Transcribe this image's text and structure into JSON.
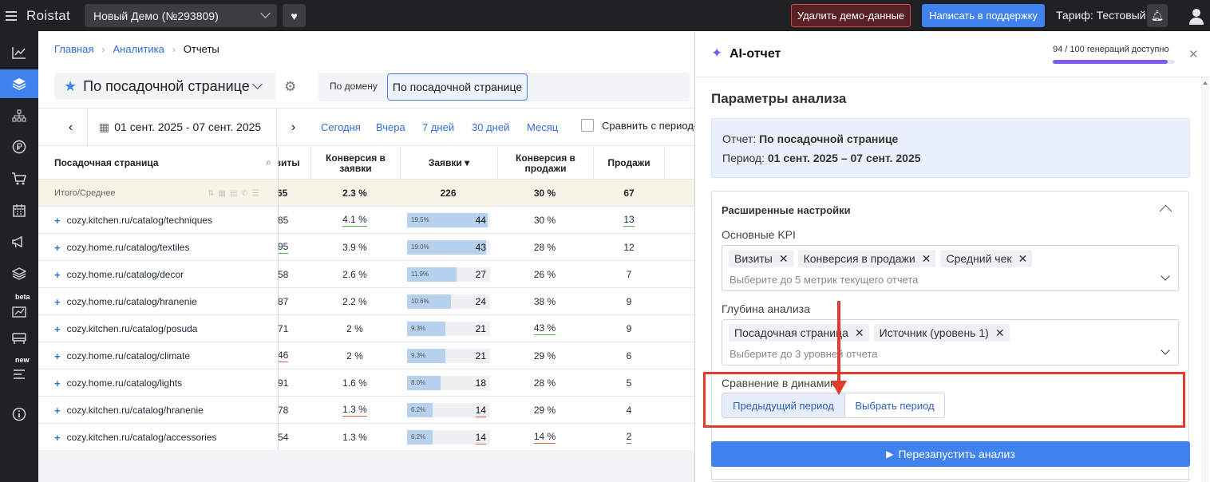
{
  "topbar": {
    "logo": "Roistat",
    "project": "Новый Демо (№293809)",
    "delete_demo": "Удалить демо-данные",
    "support": "Написать в поддержку",
    "tariff": "Тариф: Тестовый"
  },
  "sidebar": {
    "badge_beta": "beta",
    "badge_new": "new"
  },
  "breadcrumbs": {
    "home": "Главная",
    "analytics": "Аналитика",
    "current": "Отчеты"
  },
  "report": {
    "selector": "По посадочной странице",
    "tab_domain": "По домену",
    "tab_landing": "По посадочной странице"
  },
  "dates": {
    "range": "01 сент. 2025 - 07 сент. 2025",
    "today": "Сегодня",
    "yesterday": "Вчера",
    "week": "7 дней",
    "month30": "30 дней",
    "month": "Месяц",
    "compare": "Сравнить с периодом"
  },
  "table": {
    "headers": {
      "landing": "Посадочная страница",
      "visits": "Визиты",
      "conv_leads": "Конверсия в заявки",
      "leads": "Заявки ▾",
      "conv_sales": "Конверсия в продажи",
      "sales": "Продажи"
    },
    "total": {
      "label": "Итого/Среднее",
      "visits": "65",
      "conv_leads": "2.3 %",
      "leads": "226",
      "conv_sales": "30 %",
      "sales": "67"
    },
    "rows": [
      {
        "page": "cozy.kitchen.ru/catalog/techniques",
        "visits": "85",
        "conv_leads": "4.1 %",
        "share": "19.5%",
        "share_value": 19.5,
        "leads": "44",
        "conv_sales": "30 %",
        "sales": "13"
      },
      {
        "page": "cozy.home.ru/catalog/textiles",
        "visits": "95",
        "conv_leads": "3.9 %",
        "share": "19.0%",
        "share_value": 19.0,
        "leads": "43",
        "conv_sales": "28 %",
        "sales": "12"
      },
      {
        "page": "cozy.home.ru/catalog/decor",
        "visits": "58",
        "conv_leads": "2.6 %",
        "share": "11.9%",
        "share_value": 11.9,
        "leads": "27",
        "conv_sales": "26 %",
        "sales": "7"
      },
      {
        "page": "cozy.home.ru/catalog/hranenie",
        "visits": "87",
        "conv_leads": "2.2 %",
        "share": "10.6%",
        "share_value": 10.6,
        "leads": "24",
        "conv_sales": "38 %",
        "sales": "9"
      },
      {
        "page": "cozy.kitchen.ru/catalog/posuda",
        "visits": "71",
        "conv_leads": "2 %",
        "share": "9.3%",
        "share_value": 9.3,
        "leads": "21",
        "conv_sales": "43 %",
        "sales": "9"
      },
      {
        "page": "cozy.home.ru/catalog/climate",
        "visits": "46",
        "conv_leads": "2 %",
        "share": "9.3%",
        "share_value": 9.3,
        "leads": "21",
        "conv_sales": "29 %",
        "sales": "6"
      },
      {
        "page": "cozy.home.ru/catalog/lights",
        "visits": "91",
        "conv_leads": "1.6 %",
        "share": "8.0%",
        "share_value": 8.0,
        "leads": "18",
        "conv_sales": "28 %",
        "sales": "5"
      },
      {
        "page": "cozy.kitchen.ru/catalog/hranenie",
        "visits": "78",
        "conv_leads": "1.3 %",
        "share": "6.2%",
        "share_value": 6.2,
        "leads": "14",
        "conv_sales": "29 %",
        "sales": "4"
      },
      {
        "page": "cozy.kitchen.ru/catalog/accessories",
        "visits": "54",
        "conv_leads": "1.3 %",
        "share": "6.2%",
        "share_value": 6.2,
        "leads": "14",
        "conv_sales": "14 %",
        "sales": "2"
      }
    ]
  },
  "ai_panel": {
    "title": "AI-отчет",
    "quota": "94 / 100 генераций доступно",
    "quota_used": 94,
    "quota_total": 100,
    "params_title": "Параметры анализа",
    "report_label": "Отчет:",
    "report_value": "По посадочной странице",
    "period_label": "Период:",
    "period_value": "01 сент. 2025 – 07 сент. 2025",
    "advanced_title": "Расширенные настройки",
    "kpi_label": "Основные KPI",
    "kpi_chips": [
      "Визиты",
      "Конверсия в продажи",
      "Средний чек"
    ],
    "kpi_placeholder": "Выберите до 5 метрик текущего отчета",
    "depth_label": "Глубина анализа",
    "depth_chips": [
      "Посадочная страница",
      "Источник (уровень 1)"
    ],
    "depth_placeholder": "Выберите до 3 уровней отчета",
    "dynamics_label": "Сравнение в динамике",
    "prev_period": "Предыдущий период",
    "choose_period": "Выбрать период",
    "rerun": "Перезапустить анализ"
  },
  "colors": {
    "accent": "#3f82ee",
    "annotation": "#e33c2c",
    "ai": "#7c5cf0"
  }
}
